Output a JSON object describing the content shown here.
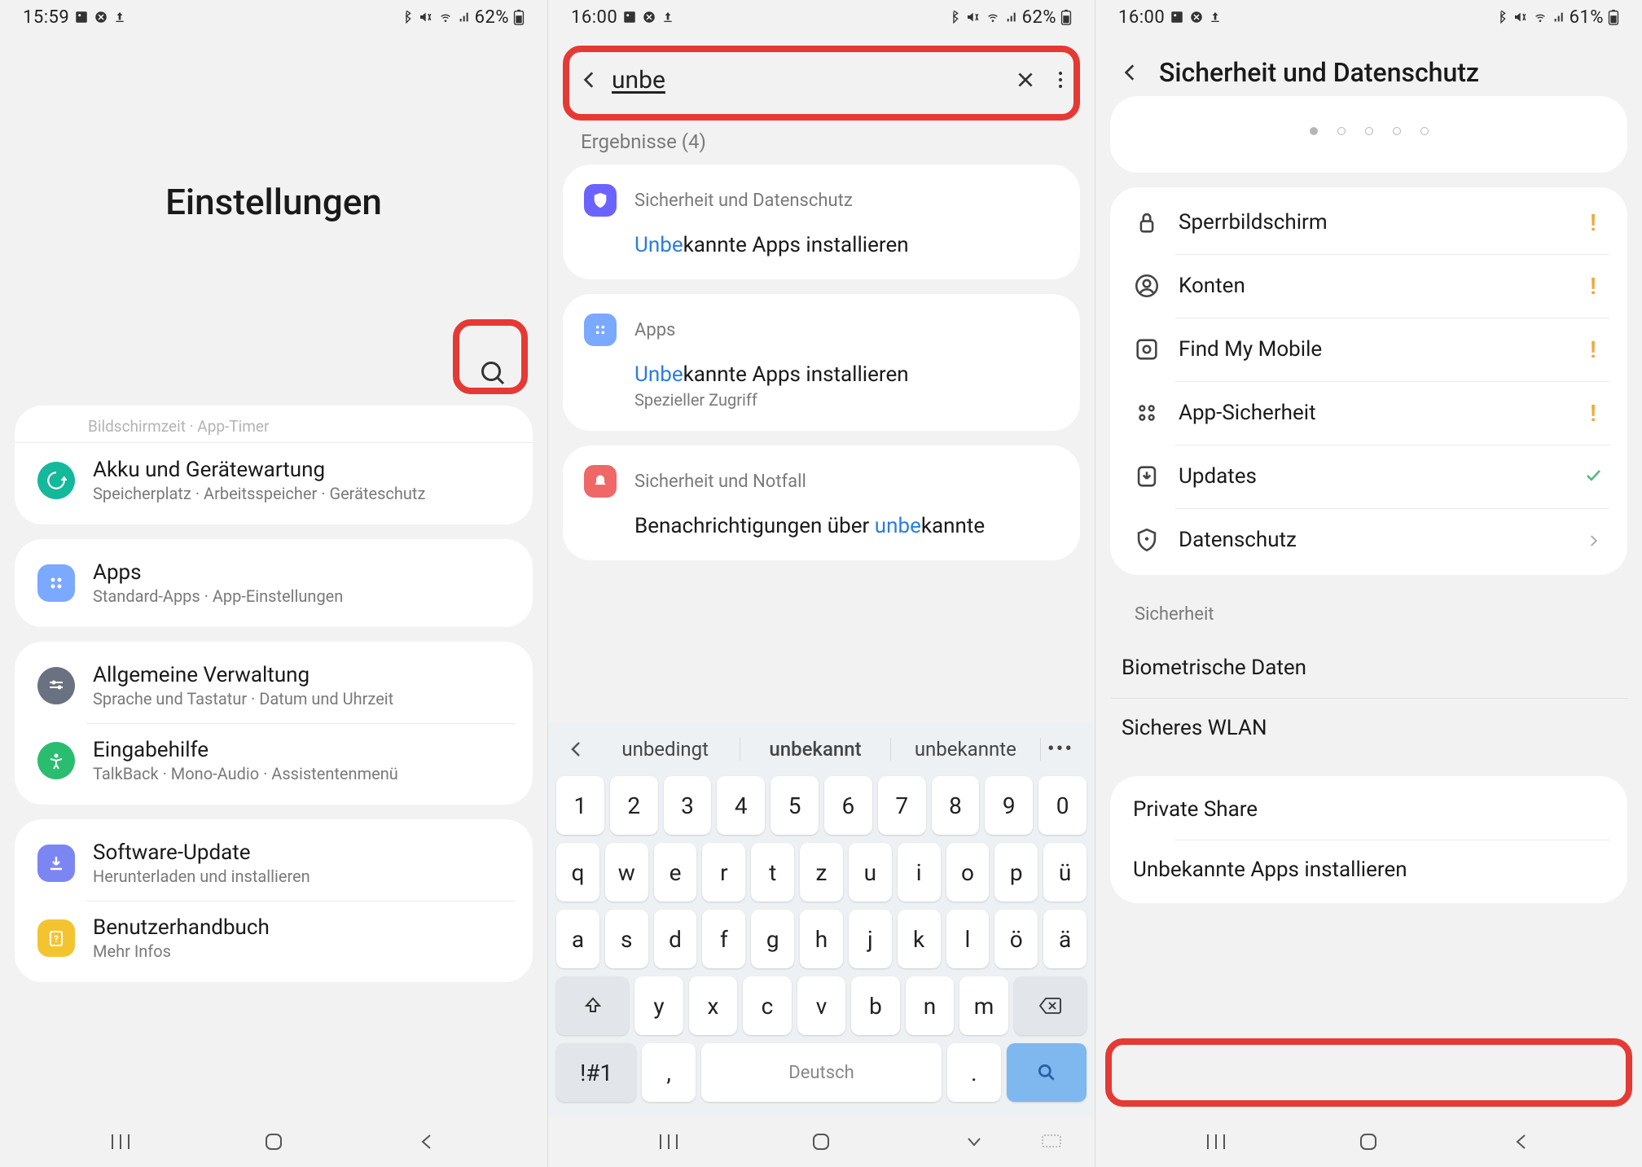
{
  "status": {
    "t1": "15:59",
    "t2": "16:00",
    "t3": "16:00",
    "b1": "62%",
    "b2": "62%",
    "b3": "61%"
  },
  "s1": {
    "title": "Einstellungen",
    "peek": "Bildschirmzeit  ·  App-Timer",
    "rows": [
      {
        "title": "Akku und Gerätewartung",
        "sub": "Speicherplatz  ·  Arbeitsspeicher  ·  Geräteschutz",
        "icon": "loop",
        "bg": "#14b89a"
      },
      {
        "title": "Apps",
        "sub": "Standard-Apps  ·  App-Einstellungen",
        "icon": "grid",
        "bg": "#7aa9ff"
      },
      {
        "title": "Allgemeine Verwaltung",
        "sub": "Sprache und Tastatur  ·  Datum und Uhrzeit",
        "icon": "sliders",
        "bg": "#6a7180"
      },
      {
        "title": "Eingabehilfe",
        "sub": "TalkBack  ·  Mono-Audio  ·  Assistentenmenü",
        "icon": "person",
        "bg": "#2bbd6f"
      },
      {
        "title": "Software-Update",
        "sub": "Herunterladen und installieren",
        "icon": "download",
        "bg": "#7c86f2"
      },
      {
        "title": "Benutzerhandbuch",
        "sub": "Mehr Infos",
        "icon": "help",
        "bg": "#f4c430"
      }
    ]
  },
  "s2": {
    "query": "unbe",
    "results_label": "Ergebnisse (4)",
    "groups": [
      {
        "cat": "Sicherheit und Datenschutz",
        "icon": "shield",
        "bg": "#6c63ff",
        "items": [
          {
            "pre": "Unbe",
            "rest": "kannte Apps installieren",
            "sub": ""
          }
        ]
      },
      {
        "cat": "Apps",
        "icon": "grid",
        "bg": "#7aa9ff",
        "items": [
          {
            "pre": "Unbe",
            "rest": "kannte Apps installieren",
            "sub": "Spezieller Zugriff"
          }
        ]
      },
      {
        "cat": "Sicherheit und Notfall",
        "icon": "alarm",
        "bg": "#f06767",
        "items": [
          {
            "line1a": "Benachrichtigungen über ",
            "line1b": "unbe",
            "line1c": "kannte"
          }
        ]
      }
    ],
    "sugg": [
      "unbedingt",
      "unbekannt",
      "unbekannte"
    ],
    "kb": {
      "row1": [
        "1",
        "2",
        "3",
        "4",
        "5",
        "6",
        "7",
        "8",
        "9",
        "0"
      ],
      "row2": [
        "q",
        "w",
        "e",
        "r",
        "t",
        "z",
        "u",
        "i",
        "o",
        "p",
        "ü"
      ],
      "row3": [
        "a",
        "s",
        "d",
        "f",
        "g",
        "h",
        "j",
        "k",
        "l",
        "ö",
        "ä"
      ],
      "row4": [
        "y",
        "x",
        "c",
        "v",
        "b",
        "n",
        "m"
      ],
      "sym": "!#1",
      "comma": ",",
      "lang": "Deutsch",
      "dot": "."
    }
  },
  "s3": {
    "title": "Sicherheit und Datenschutz",
    "rows1": [
      {
        "label": "Sperrbildschirm",
        "icon": "lock",
        "st": "warn"
      },
      {
        "label": "Konten",
        "icon": "user",
        "st": "warn"
      },
      {
        "label": "Find My Mobile",
        "icon": "target",
        "st": "warn"
      },
      {
        "label": "App-Sicherheit",
        "icon": "grid4",
        "st": "warn"
      },
      {
        "label": "Updates",
        "icon": "dl",
        "st": "ok"
      },
      {
        "label": "Datenschutz",
        "icon": "shield2",
        "st": "chev"
      }
    ],
    "sectionHeader": "Sicherheit",
    "rows2": [
      {
        "label": "Biometrische Daten"
      },
      {
        "label": "Sicheres WLAN"
      }
    ],
    "rows3": [
      {
        "label": "Private Share"
      },
      {
        "label": "Unbekannte Apps installieren"
      }
    ]
  }
}
